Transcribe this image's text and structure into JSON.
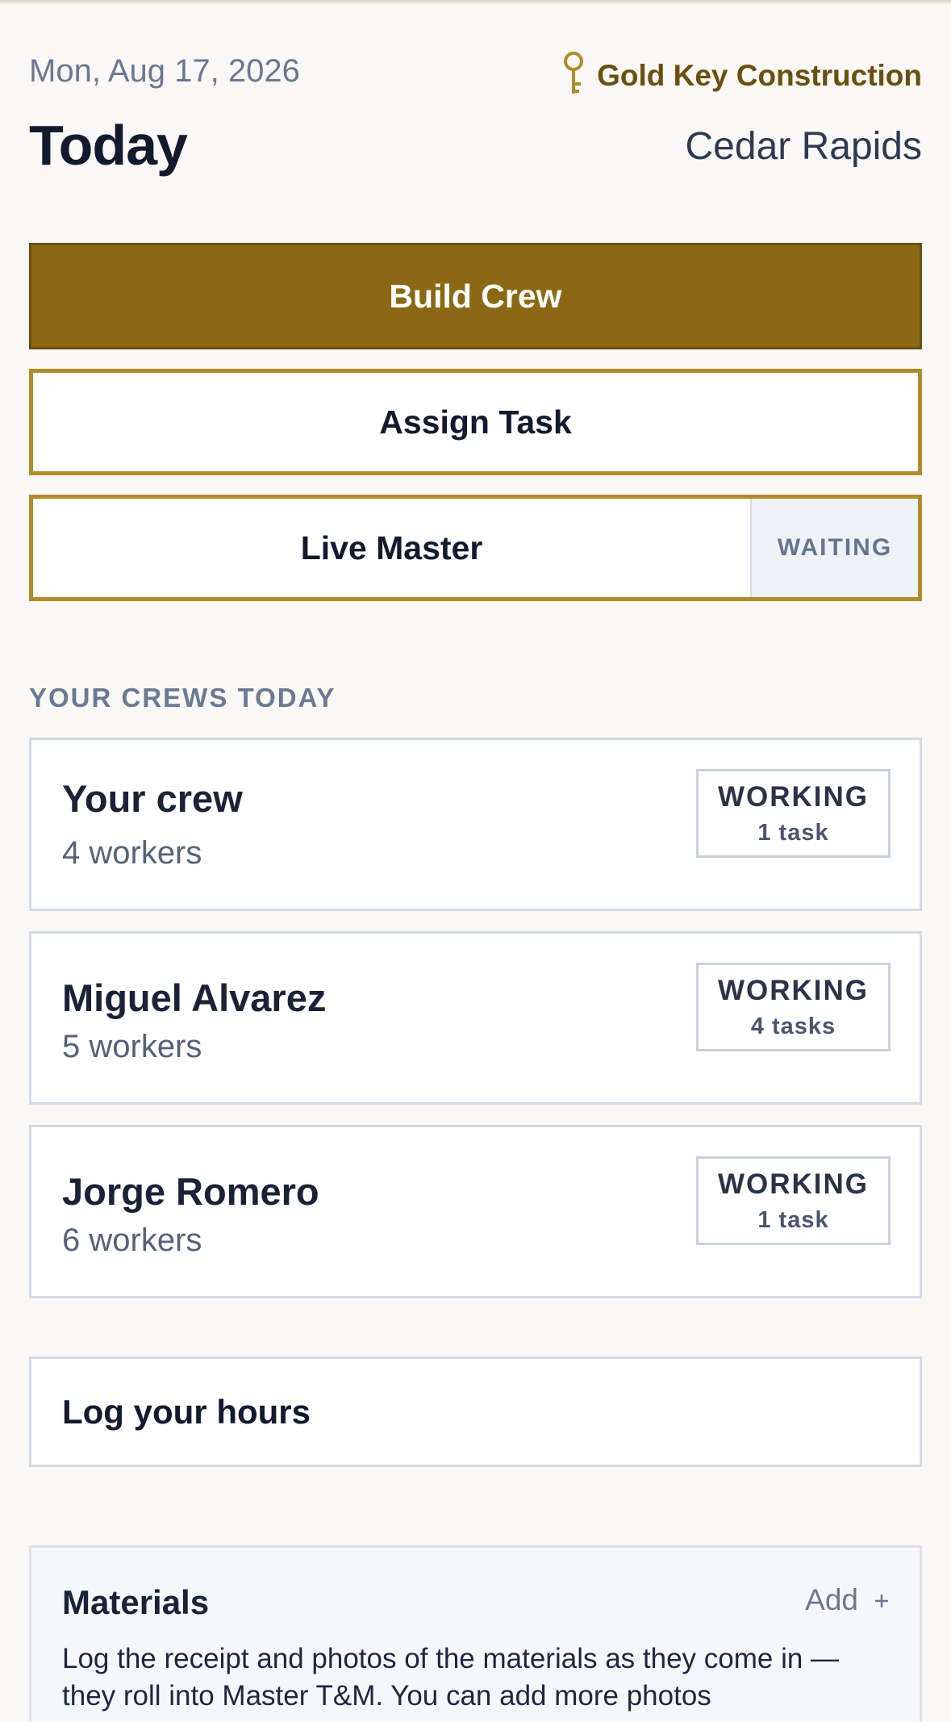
{
  "header": {
    "date": "Mon, Aug 17, 2026",
    "brand_name": "Gold Key Construction",
    "brand_icon": "key-icon",
    "title": "Today",
    "location": "Cedar Rapids"
  },
  "actions": {
    "build_crew_label": "Build Crew",
    "assign_task_label": "Assign Task",
    "live_master_label": "Live Master",
    "live_master_status": "WAITING"
  },
  "crews": {
    "section_label": "YOUR CREWS TODAY",
    "items": [
      {
        "name": "Your crew",
        "workers": "4 workers",
        "status": "WORKING",
        "tasks": "1 task"
      },
      {
        "name": "Miguel Alvarez",
        "workers": "5 workers",
        "status": "WORKING",
        "tasks": "4 tasks"
      },
      {
        "name": "Jorge Romero",
        "workers": "6 workers",
        "status": "WORKING",
        "tasks": "1 task"
      }
    ]
  },
  "log_hours": {
    "label": "Log your hours"
  },
  "materials": {
    "title": "Materials",
    "add_label": "Add",
    "add_icon": "plus-icon",
    "description": "Log the receipt and photos of the materials as they come in — they roll into Master T&M. You can add more photos"
  },
  "colors": {
    "accent": "#8b6914",
    "accent_border": "#b08d2a",
    "brand_text": "#6b4f0f",
    "background": "#f9f8f6"
  }
}
